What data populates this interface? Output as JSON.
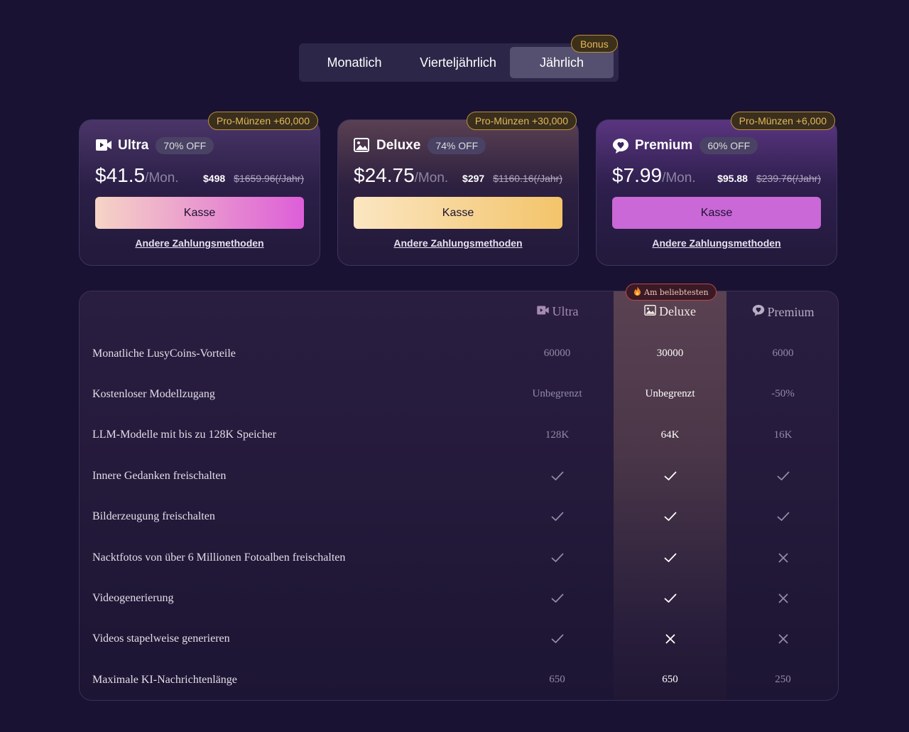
{
  "period": {
    "tabs": [
      "Monatlich",
      "Vierteljährlich",
      "Jährlich"
    ],
    "active": 2,
    "bonus_badge": "Bonus"
  },
  "plans": [
    {
      "id": "ultra",
      "icon": "video-icon",
      "name": "Ultra",
      "discount": "70% OFF",
      "coins_badge": "Pro-Münzen +60,000",
      "price": "$41.5",
      "unit": "/Mon.",
      "year_price": "$498",
      "old_price": "$1659.96(/Jahr)",
      "checkout": "Kasse",
      "other_payment": "Andere Zahlungsmethoden"
    },
    {
      "id": "deluxe",
      "icon": "image-icon",
      "name": "Deluxe",
      "discount": "74% OFF",
      "coins_badge": "Pro-Münzen +30,000",
      "price": "$24.75",
      "unit": "/Mon.",
      "year_price": "$297",
      "old_price": "$1160.16(/Jahr)",
      "checkout": "Kasse",
      "other_payment": "Andere Zahlungsmethoden"
    },
    {
      "id": "premium",
      "icon": "chat-heart-icon",
      "name": "Premium",
      "discount": "60% OFF",
      "coins_badge": "Pro-Münzen +6,000",
      "price": "$7.99",
      "unit": "/Mon.",
      "year_price": "$95.88",
      "old_price": "$239.76(/Jahr)",
      "checkout": "Kasse",
      "other_payment": "Andere Zahlungsmethoden"
    }
  ],
  "compare": {
    "popular_badge": "Am beliebtesten",
    "columns": [
      "Ultra",
      "Deluxe",
      "Premium"
    ],
    "rows": [
      {
        "label": "Monatliche LusyCoins-Vorteile",
        "values": [
          "60000",
          "30000",
          "6000"
        ]
      },
      {
        "label": "Kostenloser Modellzugang",
        "values": [
          "Unbegrenzt",
          "Unbegrenzt",
          "-50%"
        ]
      },
      {
        "label": "LLM-Modelle mit bis zu 128K Speicher",
        "values": [
          "128K",
          "64K",
          "16K"
        ]
      },
      {
        "label": "Innere Gedanken freischalten",
        "values": [
          "check",
          "check",
          "check"
        ]
      },
      {
        "label": "Bilderzeugung freischalten",
        "values": [
          "check",
          "check",
          "check"
        ]
      },
      {
        "label": "Nacktfotos von über 6 Millionen Fotoalben freischalten",
        "values": [
          "check",
          "check",
          "cross"
        ]
      },
      {
        "label": "Videogenerierung",
        "values": [
          "check",
          "check",
          "cross"
        ]
      },
      {
        "label": "Videos stapelweise generieren",
        "values": [
          "check",
          "cross",
          "cross"
        ]
      },
      {
        "label": "Maximale KI-Nachrichtenlänge",
        "values": [
          "650",
          "650",
          "250"
        ]
      }
    ]
  },
  "colors": {
    "background": "#1a1232",
    "gold": "#e2b95a",
    "ultra_button": "#dd5ed8",
    "deluxe_button": "#f3c46a",
    "premium_button": "#c968d6"
  }
}
